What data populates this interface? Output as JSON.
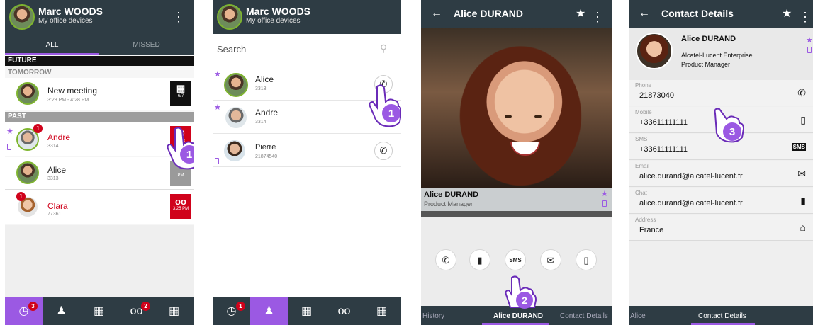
{
  "colors": {
    "header": "#2e3c44",
    "accent": "#9b59e3",
    "missed": "#d0021b",
    "ring": "#7fb52f"
  },
  "screen1": {
    "user_name": "Marc WOODS",
    "user_sub": "My office devices",
    "menu_icon": "kebab-icon",
    "tabs": [
      "ALL",
      "MISSED"
    ],
    "sections": {
      "future": "FUTURE",
      "tomorrow": "TOMORROW",
      "past": "PAST"
    },
    "meeting": {
      "title": "New meeting",
      "time": "3:28 PM - 4:28 PM",
      "tile_text": "6/7"
    },
    "history": [
      {
        "name": "Andre",
        "number": "3314",
        "badge": "1",
        "tile_text": "3:28",
        "missed": true
      },
      {
        "name": "Alice",
        "number": "3313",
        "tile_text": "PM"
      },
      {
        "name": "Clara",
        "number": "77361",
        "badge": "1",
        "tile_text": "3:25 PM",
        "missed": true
      }
    ],
    "bottom_nav": [
      {
        "icon": "clock-icon",
        "badge": "3"
      },
      {
        "icon": "contacts-icon"
      },
      {
        "icon": "dialpad-icon"
      },
      {
        "icon": "voicemail-icon",
        "badge": "2"
      },
      {
        "icon": "calendar-icon"
      }
    ],
    "step": "1"
  },
  "screen2": {
    "user_name": "Marc WOODS",
    "user_sub": "My office devices",
    "search_placeholder": "Search",
    "contacts": [
      {
        "name": "Alice",
        "number": "3313"
      },
      {
        "name": "Andre",
        "number": "3314"
      },
      {
        "name": "Pierre",
        "number": "21874540"
      }
    ],
    "bottom_nav_badge": "1",
    "step": "1"
  },
  "screen3": {
    "title": "Alice DURAND",
    "contact_name": "Alice DURAND",
    "contact_title": "Product Manager",
    "actions": [
      "phone-icon",
      "chat-icon",
      "sms-icon",
      "email-icon",
      "mobile-icon"
    ],
    "pager": {
      "left": "History",
      "center": "Alice DURAND",
      "right": "Contact Details"
    },
    "step": "2"
  },
  "screen4": {
    "title": "Contact Details",
    "name": "Alice DURAND",
    "company": "Alcatel-Lucent Enterprise",
    "job": "Product Manager",
    "fields": [
      {
        "label": "Phone",
        "value": "21873040",
        "icon": "phone-icon"
      },
      {
        "label": "Mobile",
        "value": "+33611111111",
        "icon": "mobile-icon"
      },
      {
        "label": "SMS",
        "value": "+33611111111",
        "icon": "sms-icon"
      },
      {
        "label": "Email",
        "value": "alice.durand@alcatel-lucent.fr",
        "icon": "email-icon"
      },
      {
        "label": "Chat",
        "value": "alice.durand@alcatel-lucent.fr",
        "icon": "chat-icon"
      },
      {
        "label": "Address",
        "value": "France",
        "icon": "home-icon"
      }
    ],
    "pager": {
      "left": "Alice",
      "center": "Contact Details"
    },
    "step": "3"
  }
}
